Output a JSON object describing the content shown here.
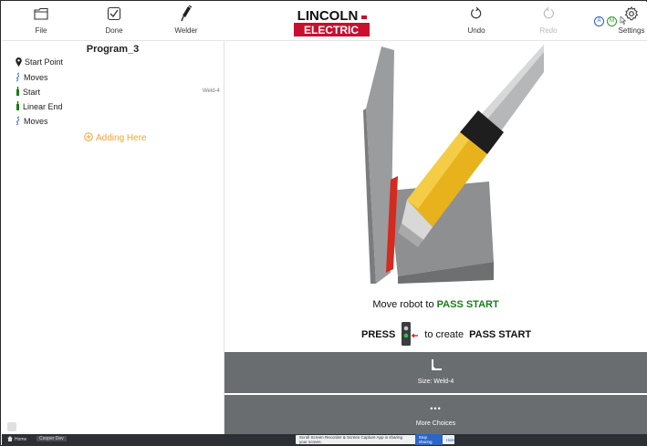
{
  "toolbar": {
    "file_label": "File",
    "done_label": "Done",
    "welder_label": "Welder",
    "undo_label": "Undo",
    "redo_label": "Redo",
    "settings_label": "Settings",
    "badge_a": "A",
    "badge_m": "M"
  },
  "logo": {
    "line1": "LINCOLN",
    "line2": "ELECTRIC",
    "brand_color": "#c8102e"
  },
  "sidebar": {
    "program_title": "Program_3",
    "items": [
      {
        "icon": "pin-icon",
        "label": "Start Point"
      },
      {
        "icon": "moves-icon",
        "label": "Moves"
      },
      {
        "icon": "weld-start-icon",
        "label": "Start",
        "tag": "Weld-4"
      },
      {
        "icon": "weld-start-icon",
        "label": "Linear End"
      },
      {
        "icon": "moves-icon",
        "label": "Moves"
      }
    ],
    "adding_label": "Adding Here"
  },
  "main": {
    "instruction_prefix": "Move robot to",
    "instruction_highlight": "PASS START",
    "press_label": "PRESS",
    "press_suffix": "to create",
    "press_highlight": "PASS START",
    "size_label": "Size: Weld-4",
    "more_dots": "•••",
    "more_label": "More Choices"
  },
  "taskbar": {
    "home_label": "Home",
    "app_label": "Cooper Dev",
    "share_message": "Scroll Screen Recorder & Screen Capture App is sharing your screen.",
    "stop_sharing": "Stop sharing",
    "hide": "Hide"
  },
  "colors": {
    "accent_green": "#1a7d1a",
    "adding_orange": "#f0a33a",
    "panel_gray": "#6a6d70"
  }
}
